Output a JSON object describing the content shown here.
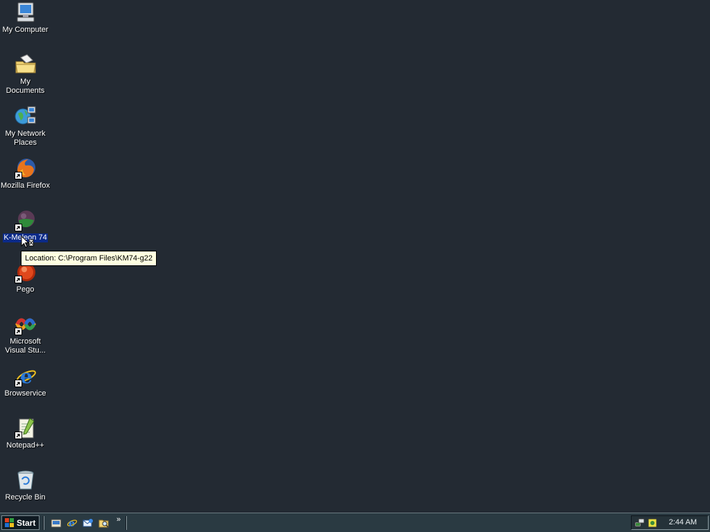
{
  "desktop": {
    "icons": [
      {
        "label": "My Computer"
      },
      {
        "label": "My Documents"
      },
      {
        "label": "My Network Places"
      },
      {
        "label": "Mozilla Firefox"
      },
      {
        "label": "K-Meleon 74"
      },
      {
        "label": "Pego"
      },
      {
        "label": "Microsoft Visual Stu..."
      },
      {
        "label": "Browservice"
      },
      {
        "label": "Notepad++"
      },
      {
        "label": "Recycle Bin"
      }
    ],
    "selected_icon": "K-Meleon 74"
  },
  "tooltip": {
    "text": "Location: C:\\Program Files\\KM74-g22"
  },
  "taskbar": {
    "start_label": "Start",
    "quick_launch_overflow": "»",
    "clock": "2:44 AM"
  },
  "colors": {
    "desktop_background": "#232a33",
    "taskbar_background": "#2a3a42",
    "selection": "#0b2a88",
    "tooltip_background": "#ffffe1"
  }
}
